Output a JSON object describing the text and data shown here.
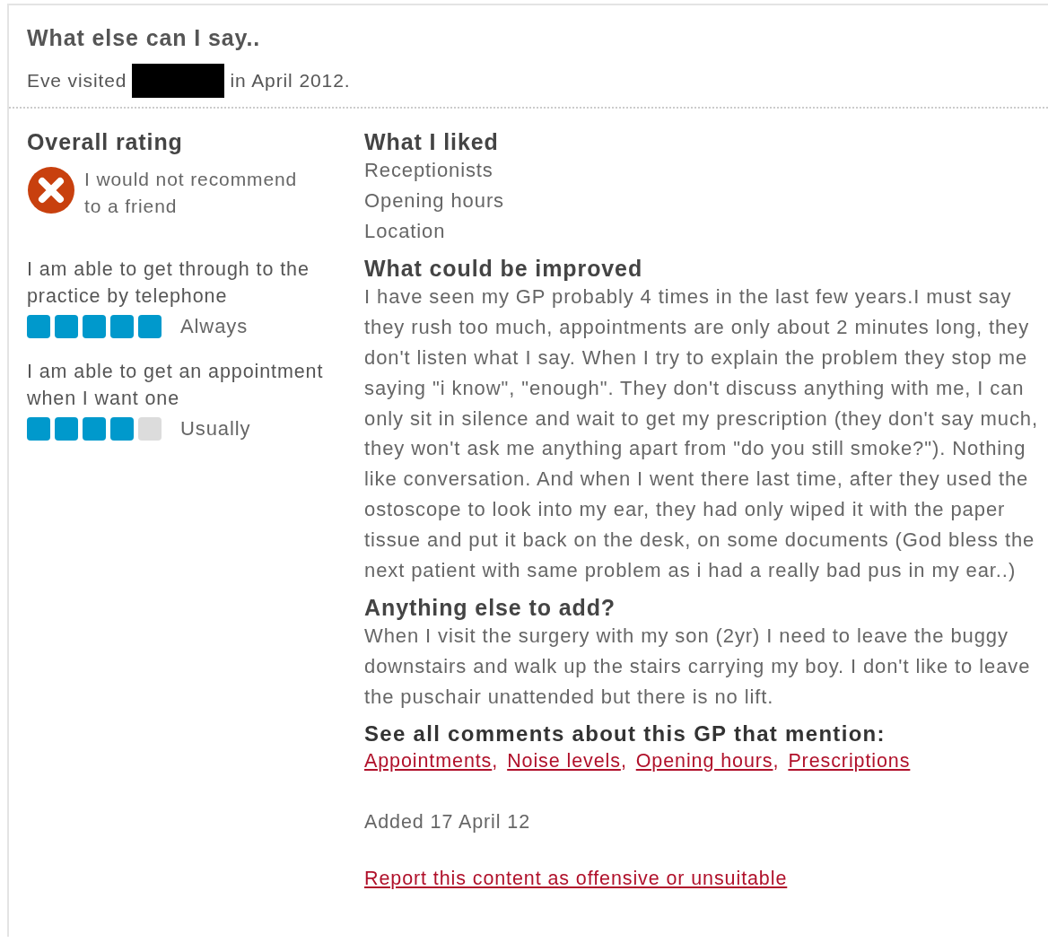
{
  "review": {
    "title": "What else can I say..",
    "visit_prefix": "Eve visited",
    "visit_suffix": "in April 2012."
  },
  "overall": {
    "heading": "Overall rating",
    "recommend": false,
    "text": "I would not recommend to a friend"
  },
  "ratings": [
    {
      "question": "I am able to get through to the practice by telephone",
      "stars": 5,
      "answer": "Always"
    },
    {
      "question": "I am able to get an appointment when I want one",
      "stars": 4,
      "answer": "Usually"
    }
  ],
  "liked": {
    "heading": "What I liked",
    "items": [
      "Receptionists",
      "Opening hours",
      "Location"
    ]
  },
  "improved": {
    "heading": "What could be improved",
    "text": "I have seen my GP probably 4 times in the last few years.I must say they rush too much, appointments are only about 2 minutes long, they don't listen what I say. When I try to explain the problem they stop me saying \"i know\", \"enough\". They don't discuss anything with me, I can only sit in silence and wait to get my prescription (they don't say much, they won't ask me anything apart from \"do you still smoke?\"). Nothing like conversation. And when I went there last time, after they used the ostoscope to look into my ear, they had only wiped it with the paper tissue and put it back on the desk, on some documents (God bless the next patient with same problem as i had a really bad pus in my ear..)"
  },
  "anything_else": {
    "heading": "Anything else to add?",
    "text": "When I visit the surgery with my son (2yr) I need to leave the buggy downstairs and walk up the stairs carrying my boy. I don't like to leave the puschair unattended but there is no lift."
  },
  "mentions": {
    "heading": "See all comments about this GP that mention:",
    "topics": [
      {
        "label": "Appointments",
        "suffix": ","
      },
      {
        "label": "Noise levels",
        "suffix": ","
      },
      {
        "label": "Opening hours",
        "suffix": ","
      },
      {
        "label": "Prescriptions"
      }
    ]
  },
  "added": "Added 17 April 12",
  "report_link": "Report this content as offensive or unsuitable"
}
